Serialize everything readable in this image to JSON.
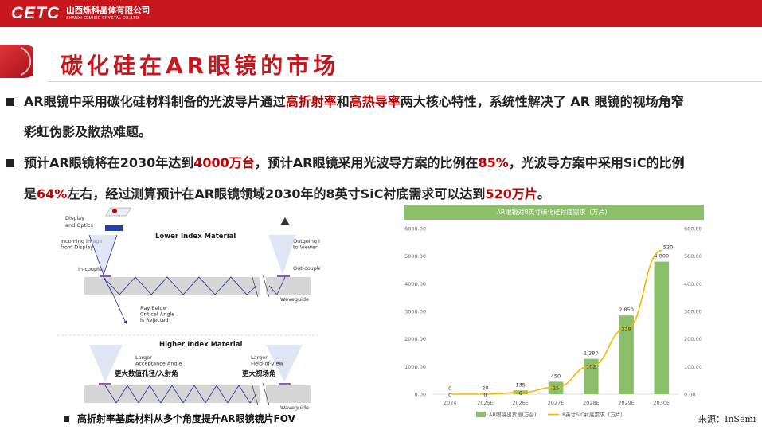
{
  "header": {
    "logo": "CETC",
    "company_cn": "山西烁科晶体有限公司",
    "company_en": "SHANXI SEMISIC CRYSTAL CO.,LTD."
  },
  "title": "碳化硅在AR眼镜的市场",
  "paragraphs": [
    {
      "line1": [
        {
          "t": "AR眼镜中采用碳化硅材料制备的光波导片通过"
        },
        {
          "t": "高折射率",
          "red": true
        },
        {
          "t": "和"
        },
        {
          "t": "高热导率",
          "red": true
        },
        {
          "t": "两大核心特性，系统性解决了 AR 眼镜的视场角窄"
        }
      ],
      "line2": [
        {
          "t": "彩虹伪影及散热难题。"
        }
      ]
    },
    {
      "line1": [
        {
          "t": "预计AR眼镜将在2030年达到"
        },
        {
          "t": "4000万台",
          "red": true
        },
        {
          "t": "，预计AR眼镜采用光波导方案的比例在"
        },
        {
          "t": "85%",
          "red": true
        },
        {
          "t": "，光波导方案中采用SiC的比例"
        }
      ],
      "line2": [
        {
          "t": "是"
        },
        {
          "t": "64%",
          "red": true
        },
        {
          "t": "左右，经过测算预计在AR眼镜领域2030年的8英寸SiC衬底需求可以达到"
        },
        {
          "t": "520万片",
          "red": true
        },
        {
          "t": "。"
        }
      ]
    }
  ],
  "diagram": {
    "display_optics": "Display\nand Optics",
    "lower_title": "Lower Index Material",
    "incoming": "Incoming Image\nfrom Display",
    "outgoing": "Outgoing Image\nto Viewer",
    "in_coupler": "In-coupler",
    "out_coupler": "Out-coupler",
    "waveguide": "Waveguide",
    "ray_below": "Ray Below\nCritical Angle\nis Rejected",
    "higher_title": "Higher Index Material",
    "larger_accept": "Larger\nAcceptance Angle",
    "larger_fov": "Larger\nField-of-View",
    "cn_left": "更大数值孔径/入射角",
    "cn_right": "更大视场角",
    "waveguide2": "Waveguide"
  },
  "caption": "高折射率基底材料从多个角度提升AR眼镜镜片FOV",
  "source": "来源：InSemi",
  "chart_data": {
    "type": "bar",
    "title": "AR眼镜对8英寸碳化硅衬底需求（万片）",
    "categories": [
      "2024",
      "2025E",
      "2026E",
      "2027E",
      "2028E",
      "2029E",
      "2030E"
    ],
    "series": [
      {
        "name": "AR眼镜出货量(万台)",
        "type": "bar",
        "axis": "left",
        "values": [
          0,
          20,
          135,
          450,
          1280,
          2850,
          4800
        ],
        "labels": [
          "0",
          "20",
          "135",
          "450",
          "1,280",
          "2,850",
          "4,800"
        ],
        "color": "#8bbf6a"
      },
      {
        "name": "8英寸SiC衬底需求（万片）",
        "type": "line",
        "axis": "right",
        "values": [
          0,
          0,
          6,
          25,
          102,
          238,
          520
        ],
        "labels": [
          "0",
          "0",
          "6",
          "25",
          "102",
          "238",
          "520"
        ],
        "color": "#f5b800"
      }
    ],
    "left_axis": {
      "ylim": [
        0,
        6000
      ],
      "ticks": [
        "0.00",
        "1000.00",
        "2000.00",
        "3000.00",
        "4000.00",
        "5000.00",
        "6000.00"
      ]
    },
    "right_axis": {
      "ylim": [
        0,
        600
      ],
      "ticks": [
        "0.00",
        "100.00",
        "200.00",
        "300.00",
        "400.00",
        "500.00",
        "600.00"
      ]
    },
    "legend": "bottom"
  },
  "colors": {
    "brand_red": "#c8161d",
    "highlight_red": "#c00000",
    "chart_green": "#8bbf6a",
    "chart_yellow": "#f5b800"
  }
}
